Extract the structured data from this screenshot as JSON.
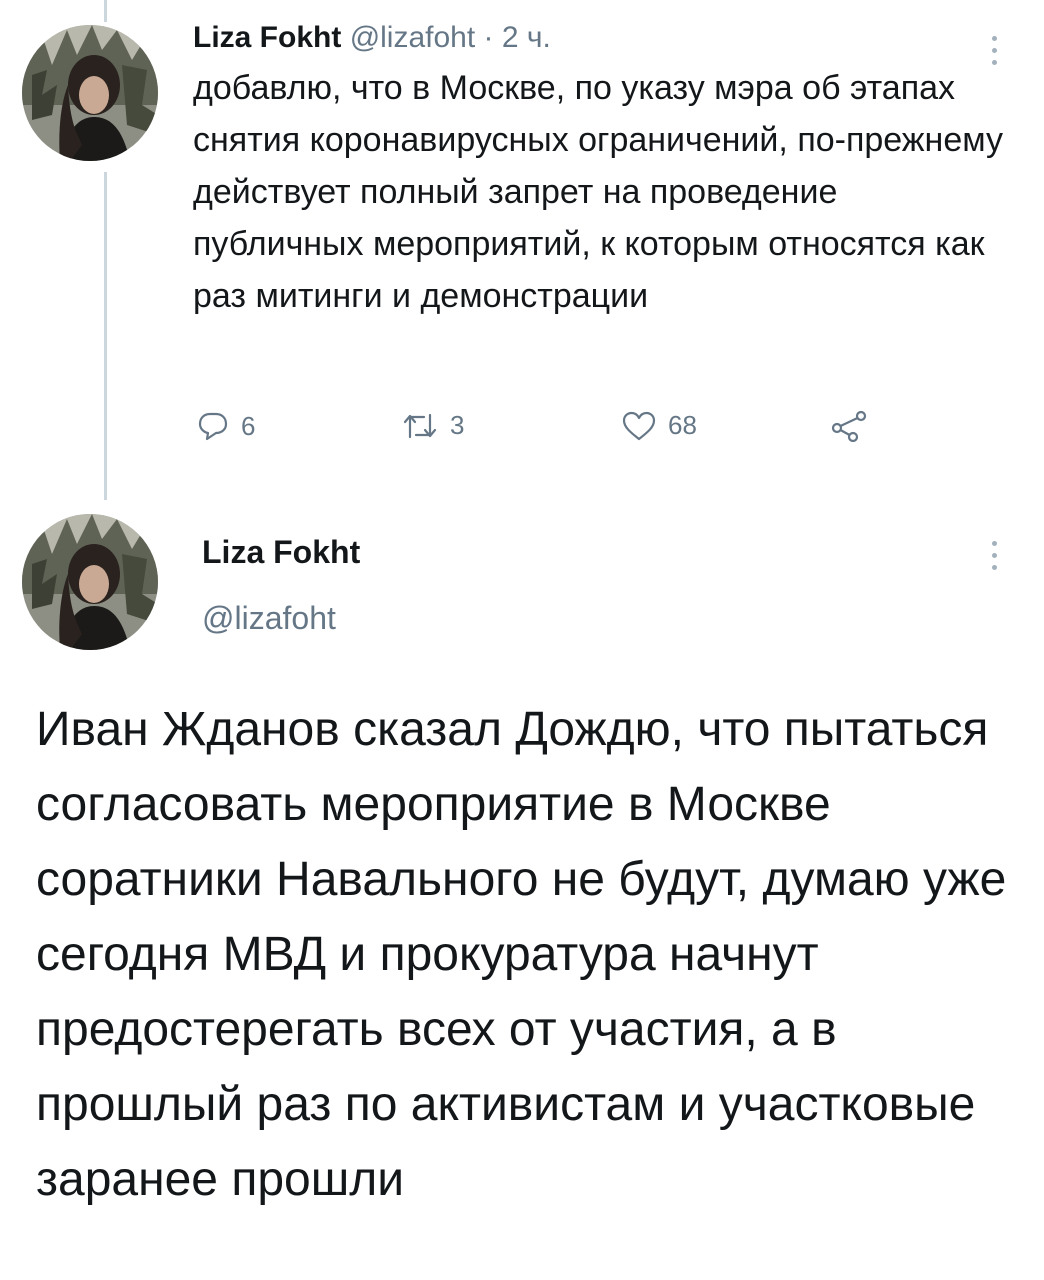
{
  "reply_tweet": {
    "author_name": "Liza Fokht",
    "handle": "@lizafoht",
    "separator": "·",
    "time": "2 ч.",
    "text": "добавлю, что в Москве, по указу мэра об этапах снятия коронавирусных ограничений, по-прежнему действует полный запрет на проведение публичных мероприятий, к которым относятся как раз митинги и демонстрации",
    "reply_count": "6",
    "retweet_count": "3",
    "like_count": "68"
  },
  "main_tweet": {
    "author_name": "Liza Fokht",
    "handle": "@lizafoht",
    "text": "Иван Жданов сказал Дождю, что пытаться согласовать мероприятие в Москве соратники Навального не будут, думаю уже сегодня МВД и прокуратура начнут предостерегать всех от участия, а в прошлый раз по активистам и участковые заранее прошли"
  },
  "icons": [
    "reply-icon",
    "retweet-icon",
    "like-icon",
    "share-icon",
    "more-icon",
    "avatar"
  ],
  "colors": {
    "text": "#14171a",
    "secondary": "#657786",
    "thread_line": "#ccd6dd"
  }
}
